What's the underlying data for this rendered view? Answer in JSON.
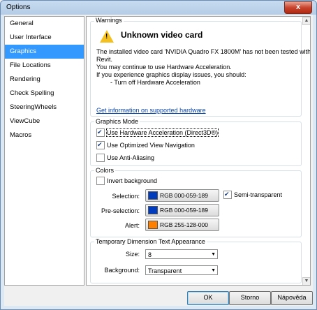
{
  "window": {
    "title": "Options",
    "close_label": "x"
  },
  "sidebar": {
    "items": [
      {
        "label": "General",
        "active": false
      },
      {
        "label": "User Interface",
        "active": false
      },
      {
        "label": "Graphics",
        "active": true
      },
      {
        "label": "File Locations",
        "active": false
      },
      {
        "label": "Rendering",
        "active": false
      },
      {
        "label": "Check Spelling",
        "active": false
      },
      {
        "label": "SteeringWheels",
        "active": false
      },
      {
        "label": "ViewCube",
        "active": false
      },
      {
        "label": "Macros",
        "active": false
      }
    ]
  },
  "warnings": {
    "group_title": "Warnings",
    "heading": "Unknown video card",
    "lines": [
      "The installed video card 'NVIDIA Quadro FX 1800M' has not been tested with",
      "Revit.",
      "You may continue to use Hardware Acceleration.",
      "If you experience graphics display issues, you should:",
      "        - Turn off Hardware Acceleration"
    ],
    "link": "Get information on supported hardware"
  },
  "graphics_mode": {
    "group_title": "Graphics Mode",
    "hardware_acceleration": {
      "label": "Use Hardware Acceleration (Direct3D®)",
      "checked": true
    },
    "optimized_navigation": {
      "label": "Use Optimized View Navigation",
      "checked": true
    },
    "anti_aliasing": {
      "label": "Use Anti-Aliasing",
      "checked": false
    }
  },
  "colors": {
    "group_title": "Colors",
    "invert_background": {
      "label": "Invert background",
      "checked": false
    },
    "selection": {
      "label": "Selection:",
      "value": "RGB 000-059-189",
      "swatch": "#003bbd"
    },
    "semi_transparent": {
      "label": "Semi-transparent",
      "checked": true
    },
    "preselection": {
      "label": "Pre-selection:",
      "value": "RGB 000-059-189",
      "swatch": "#003bbd"
    },
    "alert": {
      "label": "Alert:",
      "value": "RGB 255-128-000",
      "swatch": "#ff8000"
    }
  },
  "temp_dimension": {
    "group_title": "Temporary Dimension Text Appearance",
    "size": {
      "label": "Size:",
      "value": "8"
    },
    "background": {
      "label": "Background:",
      "value": "Transparent"
    }
  },
  "buttons": {
    "ok": "OK",
    "cancel": "Storno",
    "help": "Nápověda"
  }
}
